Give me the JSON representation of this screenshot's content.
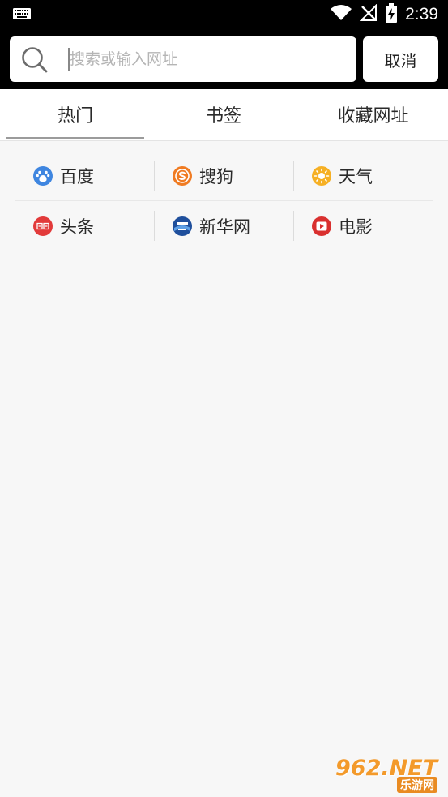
{
  "status_bar": {
    "time": "2:39"
  },
  "search": {
    "placeholder": "搜索或输入网址",
    "value": "",
    "cancel_label": "取消"
  },
  "tabs": [
    {
      "label": "热门",
      "active": true
    },
    {
      "label": "书签",
      "active": false
    },
    {
      "label": "收藏网址",
      "active": false
    }
  ],
  "shortcuts": [
    [
      {
        "label": "百度",
        "icon": "baidu-paw-icon",
        "color": "#3f86e0"
      },
      {
        "label": "搜狗",
        "icon": "sogou-s-icon",
        "color": "#f07b22"
      },
      {
        "label": "天气",
        "icon": "sun-icon",
        "color": "#f6b024"
      }
    ],
    [
      {
        "label": "头条",
        "icon": "toutiao-news-icon",
        "color": "#e23a3a"
      },
      {
        "label": "新华网",
        "icon": "xinhua-icon",
        "color": "#1f4f9c"
      },
      {
        "label": "电影",
        "icon": "play-icon",
        "color": "#d9302f"
      }
    ]
  ],
  "watermark": {
    "brand": "962.NET",
    "site": "乐游网"
  }
}
